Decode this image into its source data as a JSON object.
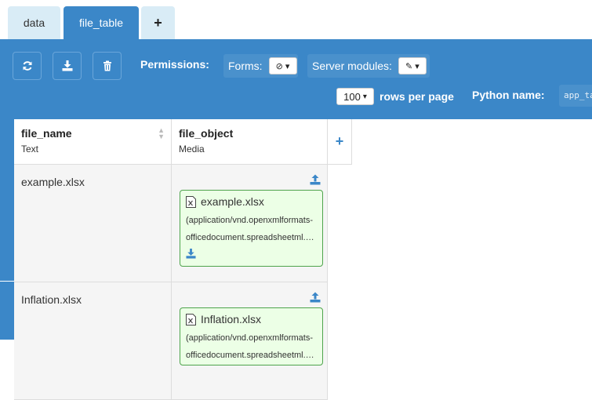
{
  "tabs": [
    {
      "label": "data"
    },
    {
      "label": "file_table"
    },
    {
      "label": "+"
    }
  ],
  "toolbar": {
    "permissions_label": "Permissions:",
    "forms_label": "Forms:",
    "server_modules_label": "Server modules:",
    "rows_per_page_value": "100",
    "rows_per_page_label": "rows per page",
    "python_name_label": "Python name:",
    "python_name_value": "app_tables.file_table"
  },
  "columns": [
    {
      "name": "file_name",
      "type": "Text"
    },
    {
      "name": "file_object",
      "type": "Media"
    }
  ],
  "rows": [
    {
      "file_name": "example.xlsx",
      "media_name": "example.xlsx",
      "media_type_1": "(application/vnd.openxmlformats-",
      "media_type_2": "officedocument.spreadsheetml.sheet)"
    },
    {
      "file_name": "Inflation.xlsx",
      "media_name": "Inflation.xlsx",
      "media_type_1": "(application/vnd.openxmlformats-",
      "media_type_2": "officedocument.spreadsheetml.sheet)"
    }
  ],
  "colors": {
    "accent": "#3b87c8",
    "media_bg": "#ecffe6",
    "media_border": "#4ea34c"
  }
}
